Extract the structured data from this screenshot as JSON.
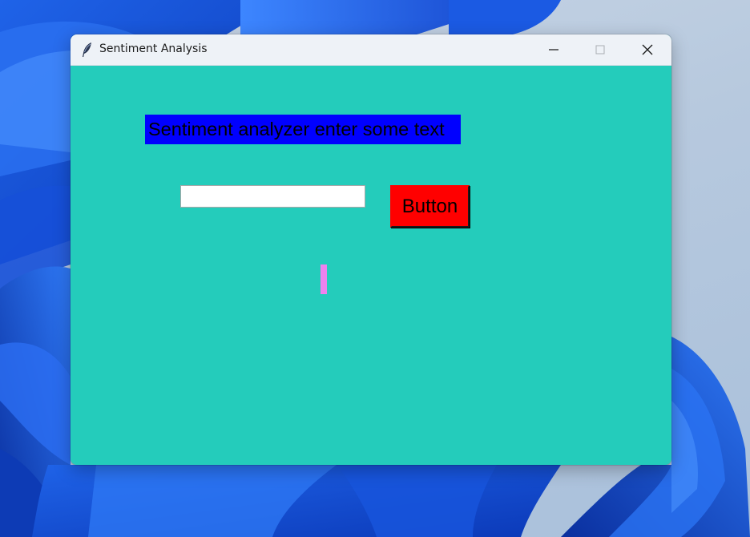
{
  "window": {
    "title": "Sentiment Analysis",
    "icon": "feather-icon",
    "background_color": "#24ccbb",
    "controls": [
      "minimize-icon",
      "maximize-icon",
      "close-icon"
    ]
  },
  "main": {
    "heading_text": "Sentiment analyzer enter some text",
    "heading_background": "#0000ff",
    "input": {
      "value": "",
      "placeholder": ""
    },
    "button_label": "Button",
    "button_color": "#ff0000",
    "result_text": "",
    "result_background": "#ee82ee"
  },
  "desktop": {
    "wallpaper": "windows-11-bloom"
  }
}
